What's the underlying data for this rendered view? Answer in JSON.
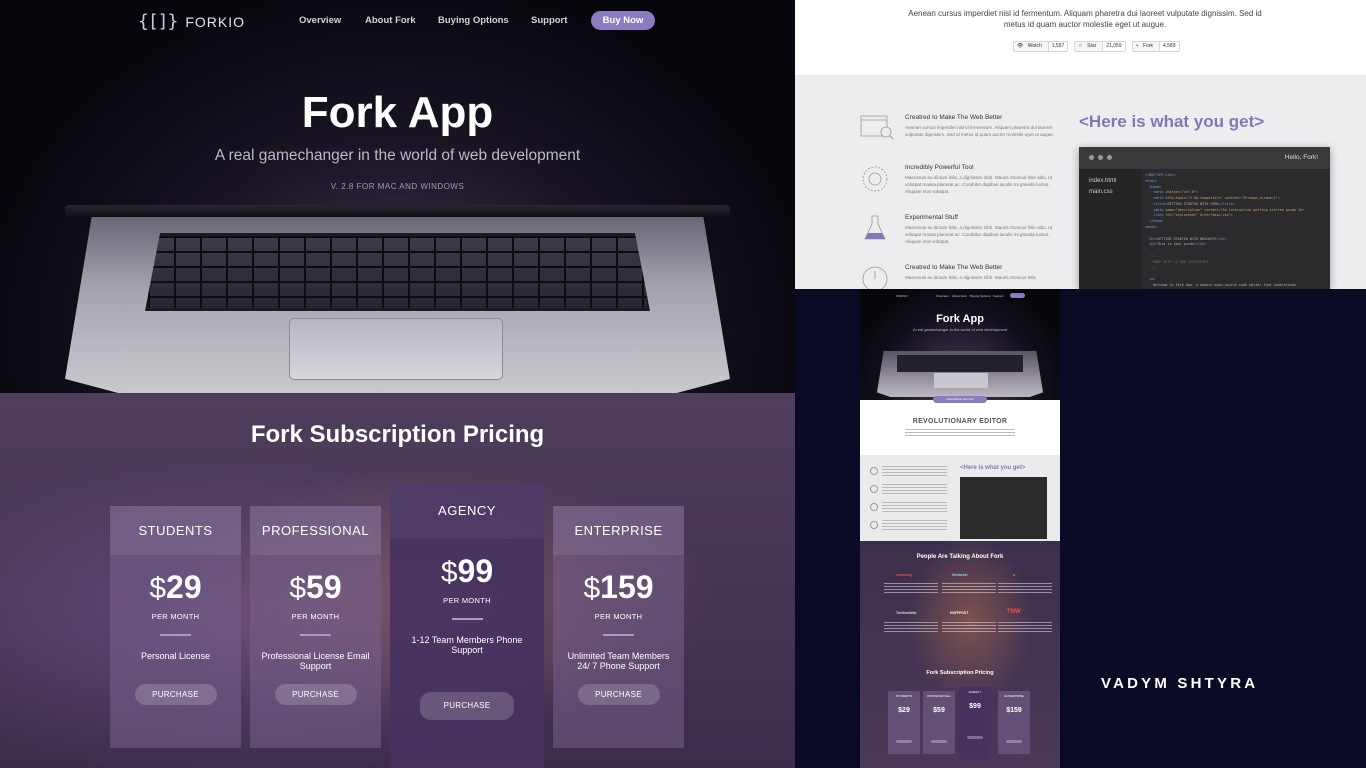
{
  "nav": {
    "logo_glyph": "{[]}",
    "logo_text": "FORKIO",
    "links": [
      "Overview",
      "About Fork",
      "Buying Options",
      "Support"
    ],
    "buy_now": "Buy Now"
  },
  "hero": {
    "title": "Fork App",
    "subtitle": "A real gamechanger in the world of web development",
    "version": "V. 2.8 FOR MAC AND WINDOWS"
  },
  "pricing": {
    "title": "Fork Subscription Pricing",
    "plans": [
      {
        "name": "STUDENTS",
        "currency": "$",
        "price": "29",
        "per": "PER MONTH",
        "feature": "Personal License",
        "button": "PURCHASE"
      },
      {
        "name": "PROFESSIONAL",
        "currency": "$",
        "price": "59",
        "per": "PER MONTH",
        "feature": "Professional License Email Support",
        "button": "PURCHASE"
      },
      {
        "name": "AGENCY",
        "currency": "$",
        "price": "99",
        "per": "PER MONTH",
        "feature": "1-12 Team Members Phone Support",
        "button": "PURCHASE"
      },
      {
        "name": "ENTERPRISE",
        "currency": "$",
        "price": "159",
        "per": "PER MONTH",
        "feature": "Unlimited Team Members 24/ 7 Phone Support",
        "button": "PURCHASE"
      }
    ]
  },
  "features_panel": {
    "intro": "Aenean cursus imperdiet nisl id fermentum. Aliquam pharetra dui laoreet vulputate dignissim. Sed id metus id quam auctor molestie eget ut augue.",
    "github": [
      {
        "label": "Watch",
        "count": "1,597"
      },
      {
        "label": "Star",
        "count": "21,059"
      },
      {
        "label": "Fork",
        "count": "4,589"
      }
    ],
    "items": [
      {
        "title": "Creatred to Make The Web Better",
        "text": "Aenean cursus imperdiet nisl id fermentum. Aliquam pharetra dui laoreet vulputate dignissim. Sed id metus id quam auctor molestie eget ut augue."
      },
      {
        "title": "Incredibly Powerful Tool",
        "text": "Maecenas eu dictum felis, a dignissim nibh. Mauris rhoncus felis odio, ut volutpat massa placerat ac. Curabitur dapibus iaculis mi gravida luctus. Aliquam erat volutpat."
      },
      {
        "title": "Experimental Stuff",
        "text": "Maecenas eu dictum felis, a dignissim nibh. Mauris rhoncus felis odio, ut volutpat massa placerat ac. Curabitur dapibus iaculis mi gravida luctus. Aliquam erat volutpat."
      },
      {
        "title": "Creatred to Make The Web Better",
        "text": "Maecenas eu dictum felis, a dignissim nibh. Mauris rhoncus felis"
      }
    ],
    "get_title": "<Here is what you get>",
    "editor": {
      "greeting": "Hello, Fork!",
      "files": [
        "index.html",
        "main.css"
      ]
    }
  },
  "mini": {
    "title": "Fork App",
    "subtitle": "A real gamechanger in the world of web development",
    "download": "Download For Free Now",
    "editor_heading": "REVOLUTIONARY EDITOR",
    "get_title": "<Here is what you get>",
    "testimonials_title": "People Are Talking About Fork",
    "brands": [
      "smashing",
      "lifehacker",
      "",
      "TheNextWeb",
      "HUFFPOST",
      "TNW"
    ],
    "pricing_title": "Fork Subscription Pricing",
    "plans": [
      {
        "name": "STUDENTS",
        "price": "$29"
      },
      {
        "name": "PROFESSIONAL",
        "price": "$59"
      },
      {
        "name": "AGENCY",
        "price": "$99"
      },
      {
        "name": "ENTERPRISE",
        "price": "$159"
      }
    ]
  },
  "author": "VADYM SHTYRA",
  "colors": {
    "accent": "#8c7bbf",
    "get_title": "#8676b5",
    "pricing_bg": "#4e3e5c",
    "page_bg": "#0b0a24"
  }
}
